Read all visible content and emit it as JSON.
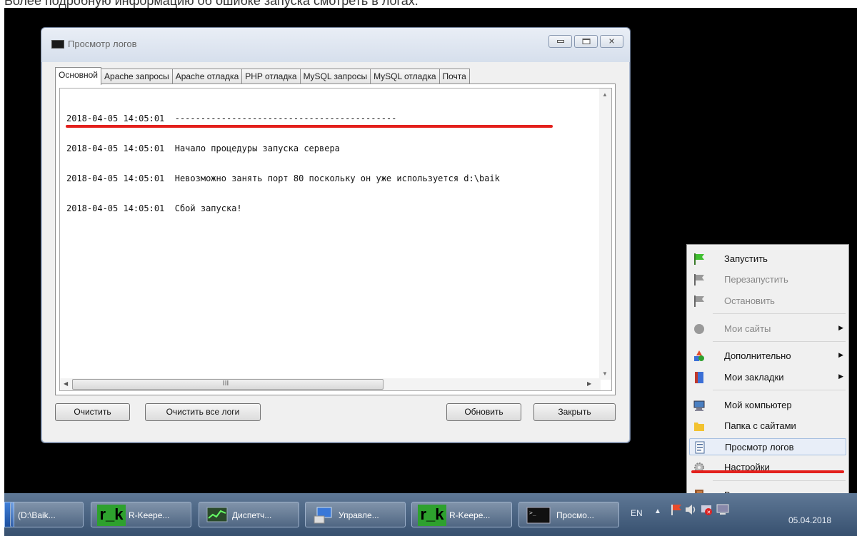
{
  "caption": "Более подробную информацию об ошибке запуска смотреть в логах.",
  "window": {
    "title": "Просмотр логов",
    "tabs": [
      "Основной",
      "Apache запросы",
      "Apache отладка",
      "PHP отладка",
      "MySQL запросы",
      "MySQL отладка",
      "Почта"
    ],
    "active_tab": "Основной",
    "log_lines": [
      "2018-04-05 14:05:01  -------------------------------------------",
      "2018-04-05 14:05:01  Начало процедуры запуска сервера",
      "2018-04-05 14:05:01  Невозможно занять порт 80 поскольку он уже используется d:\\baik",
      "2018-04-05 14:05:01  Сбой запуска!"
    ],
    "buttons": {
      "clear": "Очистить",
      "clear_all": "Очистить все логи",
      "refresh": "Обновить",
      "close": "Закрыть"
    },
    "hscroll_grip": "III"
  },
  "menu": {
    "items": [
      {
        "label": "Запустить",
        "icon": "green-flag-icon",
        "disabled": false,
        "submenu": false
      },
      {
        "label": "Перезапустить",
        "icon": "gray-flag-icon",
        "disabled": true,
        "submenu": false
      },
      {
        "label": "Остановить",
        "icon": "gray-flag-icon",
        "disabled": true,
        "submenu": false
      },
      {
        "label": "Мои сайты",
        "icon": "gray-circle-icon",
        "disabled": true,
        "submenu": true
      },
      {
        "label": "Дополнительно",
        "icon": "shapes-icon",
        "disabled": false,
        "submenu": true
      },
      {
        "label": "Мои закладки",
        "icon": "book-icon",
        "disabled": false,
        "submenu": true
      },
      {
        "label": "Мой компьютер",
        "icon": "computer-icon",
        "disabled": false,
        "submenu": false
      },
      {
        "label": "Папка с сайтами",
        "icon": "folder-icon",
        "disabled": false,
        "submenu": false
      },
      {
        "label": "Просмотр логов",
        "icon": "log-icon",
        "disabled": false,
        "submenu": false
      },
      {
        "label": "Настройки",
        "icon": "gear-icon",
        "disabled": false,
        "submenu": false
      },
      {
        "label": "Выход",
        "icon": "exit-door-icon",
        "disabled": false,
        "submenu": false
      }
    ]
  },
  "taskbar": {
    "items": [
      {
        "label": "(D:\\Baik..."
      },
      {
        "label": "R-Keepe..."
      },
      {
        "label": "Диспетч..."
      },
      {
        "label": "Управле..."
      },
      {
        "label": "R-Keepe..."
      },
      {
        "label": "Просмо..."
      }
    ],
    "rk_logo": "r_k",
    "language": "EN",
    "date": "05.04.2018"
  },
  "colors": {
    "highlight_underline": "#e3201c",
    "taskbar": "#4a6382",
    "screen_background": "#000000"
  }
}
